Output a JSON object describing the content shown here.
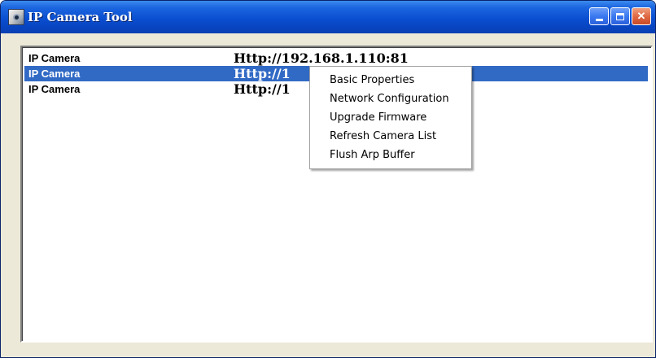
{
  "window": {
    "title": "IP Camera Tool",
    "icon": "camera-app-icon",
    "title_buttons": [
      "minimize-icon",
      "maximize-icon",
      "close-icon"
    ],
    "colors": {
      "titlebar": "#0a4fd0",
      "selection": "#316ac5",
      "face": "#ece9d8"
    }
  },
  "camera_list": {
    "rows": [
      {
        "name": "IP Camera",
        "address": "Http://192.168.1.110:81",
        "selected": false
      },
      {
        "name": "IP Camera",
        "address": "Http://1",
        "selected": true
      },
      {
        "name": "IP Camera",
        "address": "Http://1",
        "selected": false
      }
    ]
  },
  "context_menu": {
    "items": [
      "Basic Properties",
      "Network Configuration",
      "Upgrade Firmware",
      "Refresh Camera List",
      "Flush Arp Buffer"
    ]
  }
}
